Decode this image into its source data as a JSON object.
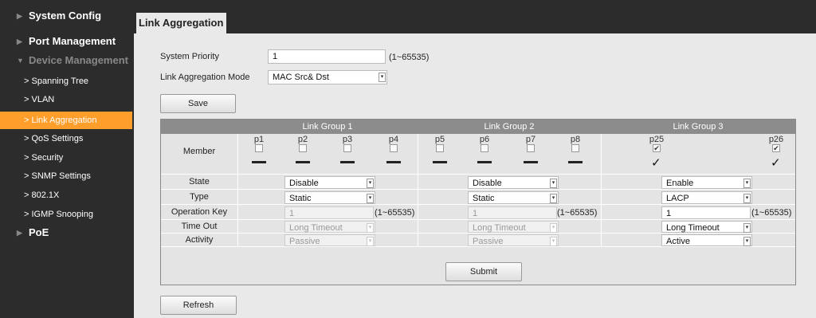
{
  "sidebar": {
    "top": [
      {
        "label": "System Config"
      },
      {
        "label": "Port Management"
      },
      {
        "label": "Device Management"
      },
      {
        "label": "PoE"
      }
    ],
    "sub": [
      {
        "label": "Spanning Tree"
      },
      {
        "label": "VLAN"
      },
      {
        "label": "Link Aggregation"
      },
      {
        "label": "QoS Settings"
      },
      {
        "label": "Security"
      },
      {
        "label": "SNMP Settings"
      },
      {
        "label": "802.1X"
      },
      {
        "label": "IGMP Snooping"
      }
    ]
  },
  "tab": {
    "label": "Link Aggregation"
  },
  "form": {
    "system_priority_label": "System Priority",
    "system_priority_value": "1",
    "system_priority_range": "(1~65535)",
    "mode_label": "Link Aggregation Mode",
    "mode_value": "MAC Src& Dst",
    "save_label": "Save"
  },
  "table": {
    "groups": [
      "Link Group 1",
      "Link Group 2",
      "Link Group 3"
    ],
    "row_labels": {
      "member": "Member",
      "state": "State",
      "type": "Type",
      "opkey": "Operation Key",
      "timeout": "Time Out",
      "activity": "Activity"
    },
    "ports": [
      "p1",
      "p2",
      "p3",
      "p4",
      "p5",
      "p6",
      "p7",
      "p8",
      "p25",
      "p26"
    ],
    "port_checked": [
      false,
      false,
      false,
      false,
      false,
      false,
      false,
      false,
      true,
      true
    ],
    "group_values": [
      {
        "state": "Disable",
        "type": "Static",
        "opkey": "1",
        "range": "(1~65535)",
        "timeout": "Long Timeout",
        "activity": "Passive"
      },
      {
        "state": "Disable",
        "type": "Static",
        "opkey": "1",
        "range": "(1~65535)",
        "timeout": "Long Timeout",
        "activity": "Passive"
      },
      {
        "state": "Enable",
        "type": "LACP",
        "opkey": "1",
        "range": "(1~65535)",
        "timeout": "Long Timeout",
        "activity": "Active"
      }
    ],
    "submit_label": "Submit"
  },
  "refresh_label": "Refresh",
  "icons": {
    "collapsed_arrow": "triangle-right-icon",
    "expanded_arrow": "triangle-down-icon",
    "submenu_arrow": "chevron-right-icon",
    "select_arrow": "select-arrow-icon",
    "check": "check-icon"
  },
  "colors": {
    "sidebar_bg": "#2c2c2c",
    "active_item": "#ff9e2a",
    "header_row": "#8c8c8c",
    "panel_bg": "#e9e9e9"
  }
}
